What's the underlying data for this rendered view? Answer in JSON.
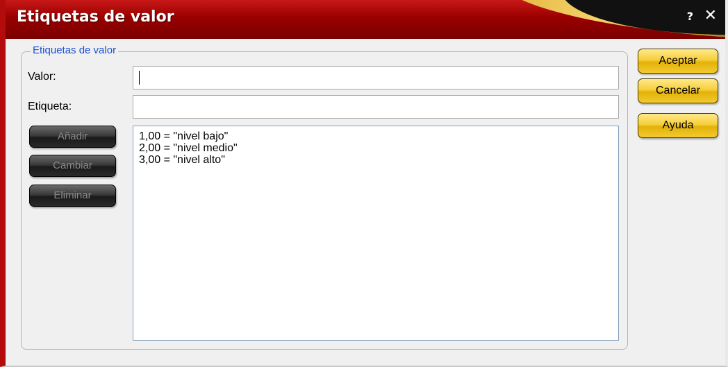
{
  "window": {
    "title": "Etiquetas de valor",
    "help_label": "?",
    "close_label": "✕"
  },
  "group": {
    "legend": "Etiquetas de valor"
  },
  "form": {
    "value_label": "Valor:",
    "value": "",
    "label_label": "Etiqueta:",
    "label_value": ""
  },
  "list": {
    "items": [
      "1,00 = \"nivel bajo\"",
      "2,00 = \"nivel medio\"",
      "3,00 = \"nivel alto\""
    ]
  },
  "actions": {
    "add": "Añadir",
    "change": "Cambiar",
    "remove": "Eliminar"
  },
  "dialog_buttons": {
    "ok": "Aceptar",
    "cancel": "Cancelar",
    "help": "Ayuda"
  },
  "colors": {
    "title_bar": "#9a0000",
    "accent_gold": "#f6cf3c",
    "legend_blue": "#1a4fd0"
  }
}
